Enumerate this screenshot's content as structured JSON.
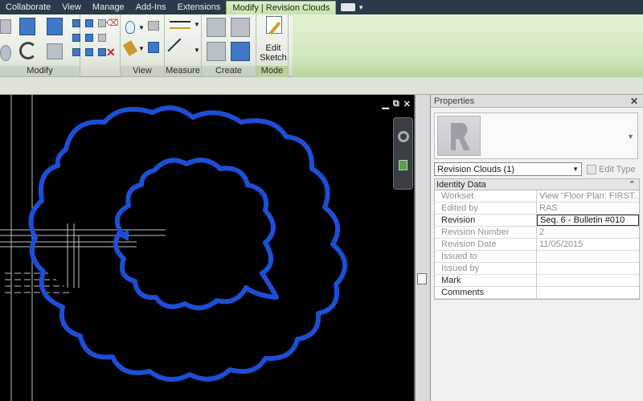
{
  "ribbon_tabs": [
    "Collaborate",
    "View",
    "Manage",
    "Add-Ins",
    "Extensions",
    "Modify | Revision Clouds"
  ],
  "ribbon_panels": {
    "modify": "Modify",
    "view": "View",
    "measure": "Measure",
    "create": "Create",
    "mode": "Mode"
  },
  "edit_sketch": {
    "line1": "Edit",
    "line2": "Sketch"
  },
  "view_controls": [
    "▁",
    "⧉",
    "✕"
  ],
  "properties": {
    "title": "Properties",
    "close": "✕",
    "type_selector": "Revision Clouds (1)",
    "edit_type": "Edit Type",
    "group": "Identity Data",
    "group_toggle": "⌃",
    "rows": [
      {
        "label": "Workset",
        "value": "View \"Floor Plan: FIRST..."
      },
      {
        "label": "Edited by",
        "value": "RAS"
      },
      {
        "label": "Revision",
        "value": "Seq. 6 - Bulletin #010"
      },
      {
        "label": "Revision Number",
        "value": "2"
      },
      {
        "label": "Revision Date",
        "value": "11/05/2015"
      },
      {
        "label": "Issued to",
        "value": ""
      },
      {
        "label": "Issued by",
        "value": ""
      },
      {
        "label": "Mark",
        "value": ""
      },
      {
        "label": "Comments",
        "value": ""
      }
    ]
  },
  "colors": {
    "cloud": "#1d4fd6",
    "canvas": "#000000",
    "contextual_tab": "#c4e3ad"
  }
}
